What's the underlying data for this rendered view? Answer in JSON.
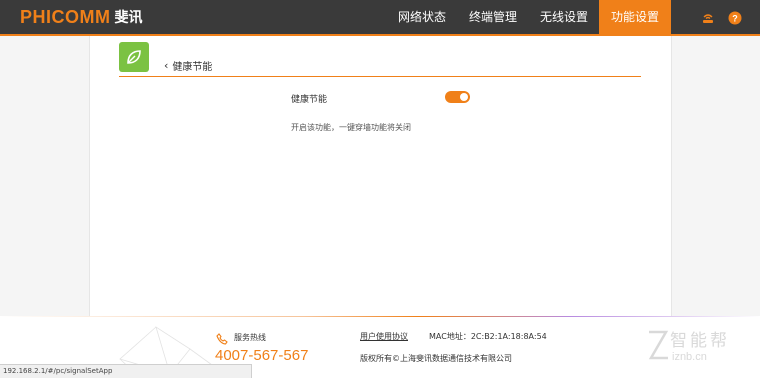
{
  "brand": {
    "logo": "PHICOMM",
    "logo_cn": "斐讯"
  },
  "nav": [
    {
      "label": "网络状态"
    },
    {
      "label": "终端管理"
    },
    {
      "label": "无线设置"
    },
    {
      "label": "功能设置"
    }
  ],
  "nav_active": "功能设置",
  "icons": [
    "router-icon",
    "help-icon",
    "leaf-icon",
    "chevron-left-icon",
    "phone-icon"
  ],
  "page": {
    "back_title": "健康节能",
    "setting_label": "健康节能",
    "toggle_on": true,
    "hint": "开启该功能，一键穿墙功能将关闭"
  },
  "footer": {
    "hotline_label": "服务热线",
    "hotline_number": "4007-567-567",
    "agreement": "用户使用协议",
    "mac": "MAC地址：2C:B2:1A:18:8A:54",
    "copyright": "版权所有©上海斐讯数据通信技术有限公司"
  },
  "watermark": {
    "text": "智能帮",
    "url": "iznb.cn"
  },
  "status_url": "192.168.2.1/#/pc/signalSetApp",
  "colors": {
    "accent": "#f08019",
    "topbar": "#3a3a3a",
    "leaf_green": "#7bc242"
  }
}
